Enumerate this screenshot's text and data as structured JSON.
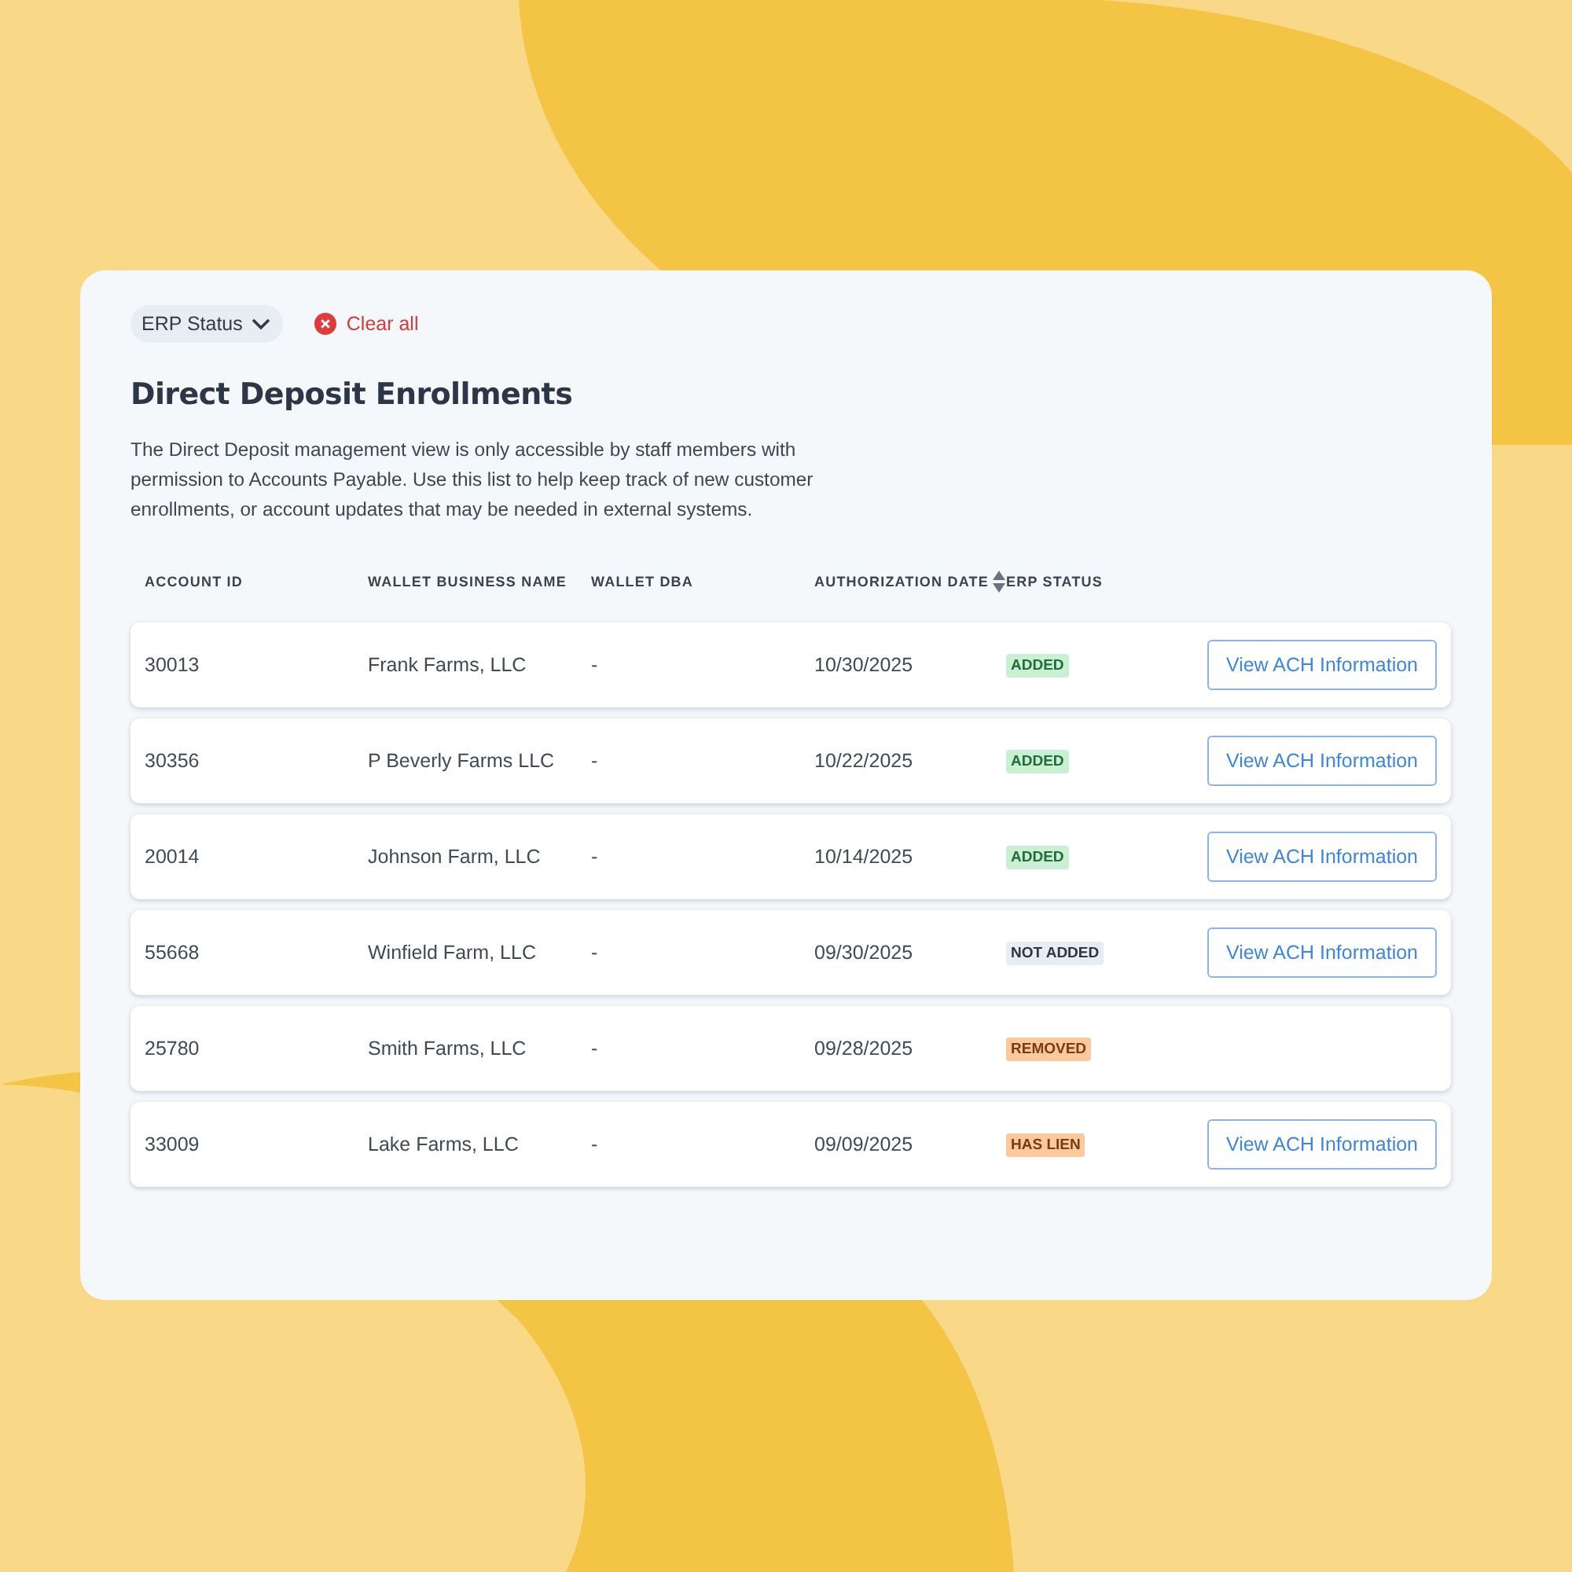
{
  "filters": {
    "dropdown": "ERP Status",
    "clear": "Clear all"
  },
  "title": "Direct Deposit Enrollments",
  "description": "The Direct Deposit management view is only accessible by staff members with permission to Accounts Payable. Use this list to help keep track of new customer enrollments, or account updates that may be needed in external systems.",
  "table": {
    "columns": [
      "ACCOUNT ID",
      "WALLET BUSINESS NAME",
      "WALLET DBA",
      "AUTHORIZATION DATE",
      "ERP STATUS"
    ],
    "rows": [
      {
        "account_id": "30013",
        "business_name": "Frank Farms, LLC",
        "dba": "-",
        "date": "10/30/2025",
        "status": "ADDED",
        "kind": "added",
        "action": "View ACH Information"
      },
      {
        "account_id": "30356",
        "business_name": "P Beverly Farms LLC",
        "dba": "-",
        "date": "10/22/2025",
        "status": "ADDED",
        "kind": "added",
        "action": "View ACH Information"
      },
      {
        "account_id": "20014",
        "business_name": "Johnson Farm, LLC",
        "dba": "-",
        "date": "10/14/2025",
        "status": "ADDED",
        "kind": "added",
        "action": "View ACH Information"
      },
      {
        "account_id": "55668",
        "business_name": "Winfield Farm, LLC",
        "dba": "-",
        "date": "09/30/2025",
        "status": "NOT ADDED",
        "kind": "not_added",
        "action": "View ACH Information"
      },
      {
        "account_id": "25780",
        "business_name": "Smith Farms, LLC",
        "dba": "-",
        "date": "09/28/2025",
        "status": "REMOVED",
        "kind": "removed"
      },
      {
        "account_id": "33009",
        "business_name": "Lake Farms, LLC",
        "dba": "-",
        "date": "09/09/2025",
        "status": "HAS LIEN",
        "kind": "has_lien",
        "action": "View ACH Information"
      }
    ]
  }
}
